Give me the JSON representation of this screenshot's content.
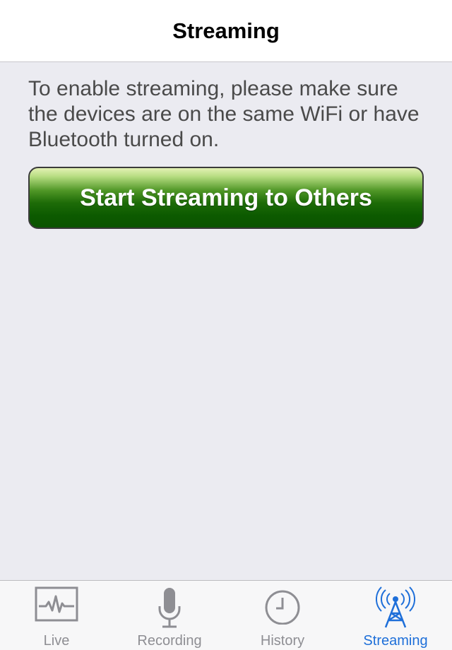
{
  "navbar": {
    "title": "Streaming"
  },
  "main": {
    "instructions": "To enable streaming, please make sure the devices are on the same WiFi or have Bluetooth turned on.",
    "start_button_label": "Start Streaming to Others"
  },
  "tabbar": {
    "active_tab": "Streaming",
    "active_color": "#1e6fd9",
    "inactive_color": "#8e8e93",
    "tabs": [
      {
        "label": "Live",
        "icon": "heartbeat-monitor-icon"
      },
      {
        "label": "Recording",
        "icon": "microphone-icon"
      },
      {
        "label": "History",
        "icon": "clock-icon"
      },
      {
        "label": "Streaming",
        "icon": "broadcast-tower-icon"
      }
    ]
  }
}
